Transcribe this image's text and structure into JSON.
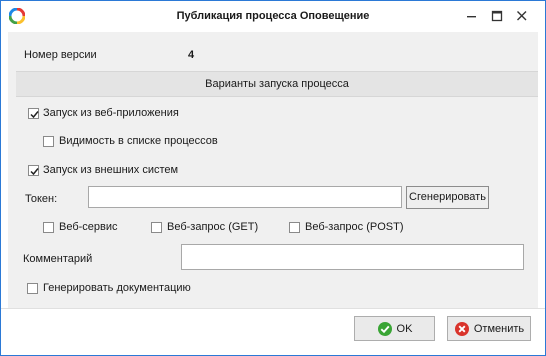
{
  "window": {
    "title": "Публикация процесса Оповещение",
    "icons": {
      "app": "app-logo-icon",
      "minimize": "minimize-icon",
      "maximize": "maximize-icon",
      "close": "close-icon"
    }
  },
  "version": {
    "label": "Номер версии",
    "value": "4"
  },
  "section": {
    "launch_options_header": "Варианты запуска процесса"
  },
  "options": {
    "web_app_launch": {
      "label": "Запуск из веб-приложения",
      "checked": true
    },
    "process_list_visibility": {
      "label": "Видимость в списке процессов",
      "checked": false
    },
    "external_launch": {
      "label": "Запуск из внешних систем",
      "checked": true
    }
  },
  "token": {
    "label": "Токен:",
    "value": "",
    "generate_label": "Сгенерировать"
  },
  "methods": {
    "web_service": {
      "label": "Веб-сервис",
      "checked": false
    },
    "web_get": {
      "label": "Веб-запрос (GET)",
      "checked": false
    },
    "web_post": {
      "label": "Веб-запрос (POST)",
      "checked": false
    }
  },
  "comment": {
    "label": "Комментарий",
    "value": ""
  },
  "generate_docs": {
    "label": "Генерировать документацию",
    "checked": false
  },
  "buttons": {
    "ok": {
      "label": "OK",
      "icon": "check-circle-icon",
      "color": "#3aa535"
    },
    "cancel": {
      "label": "Отменить",
      "icon": "cancel-circle-icon",
      "color": "#d9332b"
    }
  },
  "colors": {
    "window_border": "#2b79d6",
    "panel": "#f0f0f0"
  }
}
